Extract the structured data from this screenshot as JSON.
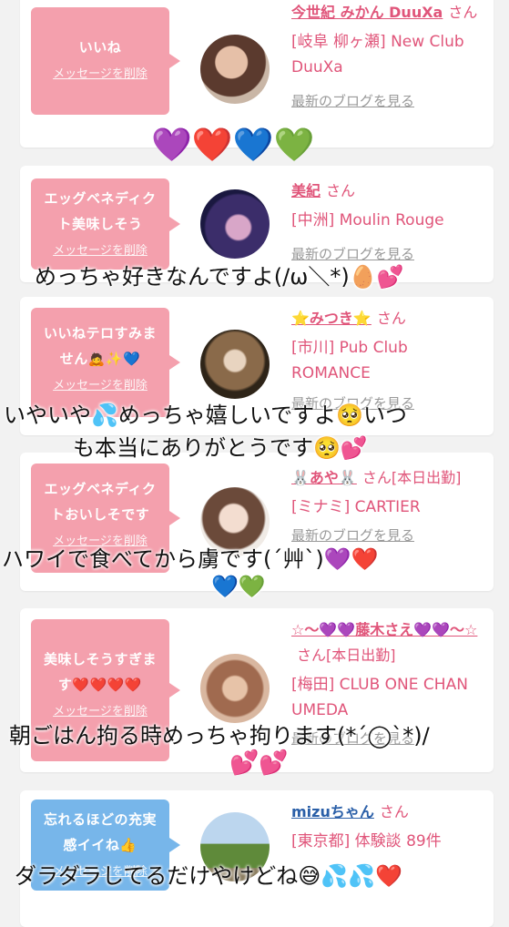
{
  "cards": [
    {
      "message": "いいね",
      "delete_label": "メッセージを削除",
      "name": "今世紀 みかん DuuXa",
      "san": "さん",
      "shop": "[岐阜 柳ヶ瀬] New Club DuuXa",
      "blog": "最新のブログを見る"
    },
    {
      "message": "エッグベネディクト美味しそう",
      "delete_label": "メッセージを削除",
      "name": "美紀",
      "san": "さん",
      "shop": "[中洲] Moulin Rouge",
      "blog": "最新のブログを見る"
    },
    {
      "message": "いいねテロすみません🙇✨💙",
      "delete_label": "メッセージを削除",
      "name": "⭐みつき⭐",
      "san": "さん",
      "shop": "[市川] Pub Club ROMANCE",
      "blog": "最新のブログを見る"
    },
    {
      "message": "エッグベネディクトおいしそです",
      "delete_label": "メッセージを削除",
      "name": "🐰あや🐰",
      "san": "さん[本日出勤]",
      "shop": "[ミナミ] CARTIER",
      "blog": "最新のブログを見る"
    },
    {
      "message": "美味しそうすぎます❤️❤️❤️❤️",
      "delete_label": "メッセージを削除",
      "name": "☆〜💜💜藤木さえ💜💜〜☆",
      "san": "さん[本日出勤]",
      "shop": "[梅田] CLUB ONE CHAN UMEDA",
      "blog": "最新のブログを見る"
    },
    {
      "message": "忘れるほどの充実感イイね👍",
      "delete_label": "メッセージを削除",
      "name": "mizuちゃん",
      "san": "さん",
      "shop": "[東京都] 体験談 89件",
      "blog": ""
    }
  ],
  "overlays": {
    "hearts1": "💜❤️💙💚",
    "line1": "めっちゃ好きなんですよ(/ω＼*)🥚💕",
    "line2": "いやいや💦めっちゃ嬉しいですよ🥺いつ",
    "line3": "も本当にありがとうです🥺💕",
    "line4": "ハワイで食べてから虜です(´艸`)💜❤️",
    "line5": "💙💚",
    "line6": "朝ごはん拘る時めっちゃ拘ります(*´◯`*)/",
    "hearts2": "💕💕",
    "line7": "ダラダラしてるだけやけどね😅💦💦❤️"
  },
  "colors": {
    "bubble_pink": "#f4a0ad",
    "bubble_blue": "#77b6ea",
    "accent": "#e0557a"
  }
}
